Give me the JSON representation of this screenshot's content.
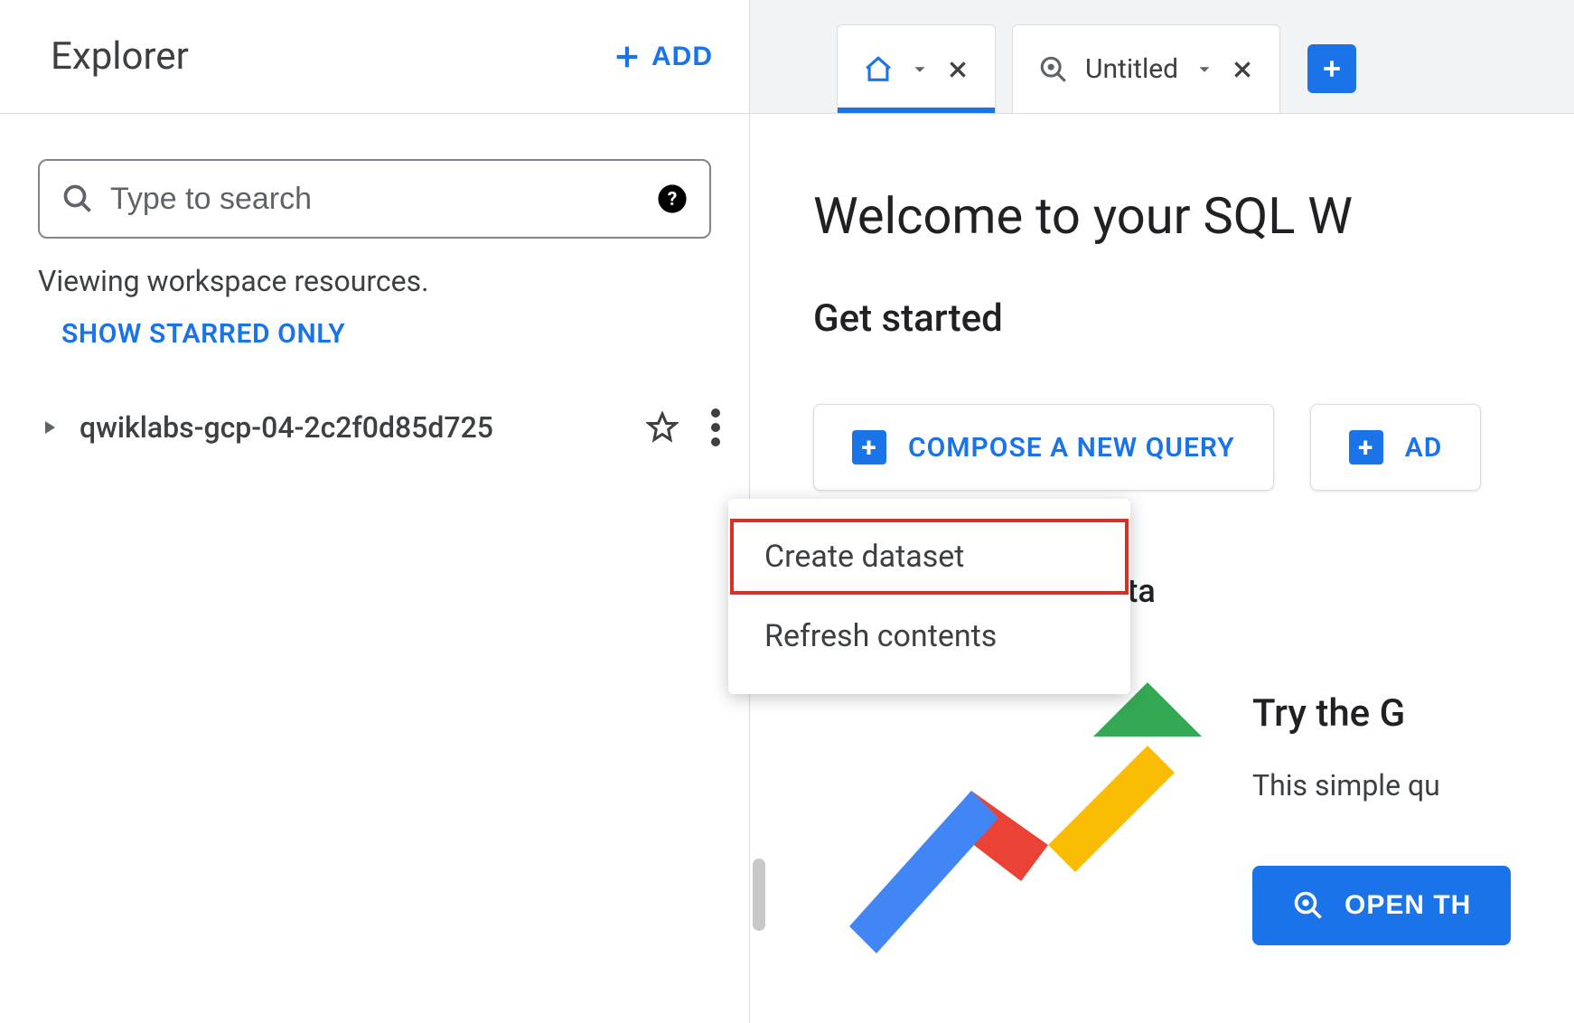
{
  "sidebar": {
    "title": "Explorer",
    "add_label": "ADD",
    "search_placeholder": "Type to search",
    "viewing_label": "Viewing workspace resources.",
    "show_starred_label": "SHOW STARRED ONLY",
    "project_id": "qwiklabs-gcp-04-2c2f0d85d725"
  },
  "context_menu": {
    "items": [
      "Create dataset",
      "Refresh contents"
    ],
    "highlighted_index": 0
  },
  "tabs": {
    "home_label": "",
    "untitled_label": "Untitled"
  },
  "main": {
    "welcome_heading": "Welcome to your SQL W",
    "get_started_label": "Get started",
    "compose_query_label": "COMPOSE A NEW QUERY",
    "add_data_label": "AD",
    "sample_data_label": "ple data",
    "try_title": "Try the G",
    "try_desc": "This simple qu",
    "open_button_label": "OPEN TH"
  },
  "icons": {
    "plus": "plus-icon",
    "collapse": "collapse-left-icon",
    "search": "magnifier-icon",
    "help": "help-circle-icon",
    "caret_right": "caret-right-icon",
    "star": "star-outline-icon",
    "kebab": "kebab-menu-icon",
    "home": "home-outline-icon",
    "chevron_down": "chevron-down-icon",
    "close": "close-icon",
    "query": "query-magnifier-icon",
    "new_tab": "plus-box-icon",
    "open_query": "query-search-icon"
  },
  "colors": {
    "primary": "#1a73e8",
    "text": "#3c4043",
    "border": "#dadce0",
    "danger": "#d93025"
  }
}
